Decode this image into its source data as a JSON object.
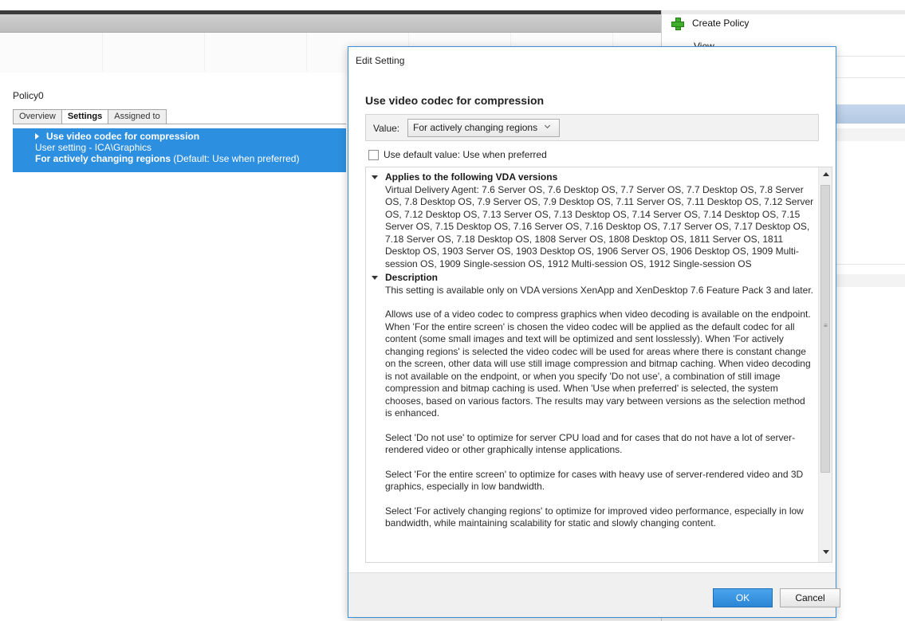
{
  "console": {
    "policy_name": "Policy0",
    "tabs": [
      {
        "label": "Overview",
        "active": false
      },
      {
        "label": "Settings",
        "active": true
      },
      {
        "label": "Assigned to",
        "active": false
      }
    ],
    "setting_row": {
      "name": "Use video codec for compression",
      "scope": "User setting - ICA\\Graphics",
      "value": "For actively changing regions",
      "default_note": " (Default: Use when preferred)"
    }
  },
  "actions_pane": {
    "create_policy": "Create Policy",
    "view": "View"
  },
  "dialog": {
    "title": "Edit Setting",
    "heading": "Use video codec for compression",
    "value_label": "Value:",
    "value_selected": "For actively changing regions",
    "use_default_label": "Use default value: Use when preferred",
    "use_default_checked": false,
    "applies_heading": "Applies to the following VDA versions",
    "applies_text": "Virtual Delivery Agent: 7.6 Server OS, 7.6 Desktop OS, 7.7 Server OS, 7.7 Desktop OS, 7.8 Server OS, 7.8 Desktop OS, 7.9 Server OS, 7.9 Desktop OS, 7.11 Server OS, 7.11 Desktop OS, 7.12 Server OS, 7.12 Desktop OS, 7.13 Server OS, 7.13 Desktop OS, 7.14 Server OS, 7.14 Desktop OS, 7.15 Server OS, 7.15 Desktop OS, 7.16 Server OS, 7.16 Desktop OS, 7.17 Server OS, 7.17 Desktop OS, 7.18 Server OS, 7.18 Desktop OS, 1808 Server OS, 1808 Desktop OS, 1811 Server OS, 1811 Desktop OS, 1903 Server OS, 1903 Desktop OS, 1906 Server OS, 1906 Desktop OS, 1909 Multi-session OS, 1909 Single-session OS, 1912 Multi-session OS, 1912 Single-session OS",
    "description_heading": "Description",
    "description_paragraphs": [
      "This setting is available only on VDA versions XenApp and XenDesktop 7.6 Feature Pack 3 and later.",
      "Allows use of a video codec to compress graphics when video decoding is available on the endpoint. When 'For the entire screen' is chosen the video codec will be applied as the default codec for all content (some small images and text will be optimized and sent losslessly). When 'For actively changing regions' is selected the video codec will be used for areas where there is constant change on the screen, other data will use still image compression and bitmap caching. When video decoding is not available on the endpoint, or when you specify 'Do not use', a combination of still image compression and bitmap caching is used. When 'Use when preferred' is selected, the system chooses, based on various factors. The results may vary between versions as the selection method is enhanced.",
      "Select 'Do not use' to optimize for server CPU load and for cases that do not have a lot of server-rendered video or other graphically intense applications.",
      "Select 'For the entire screen' to optimize for cases with heavy use of server-rendered video and 3D graphics, especially in low bandwidth.",
      "Select 'For actively changing regions' to optimize for improved video performance, especially in low bandwidth, while maintaining scalability for static and slowly changing content."
    ],
    "ok_label": "OK",
    "cancel_label": "Cancel"
  }
}
